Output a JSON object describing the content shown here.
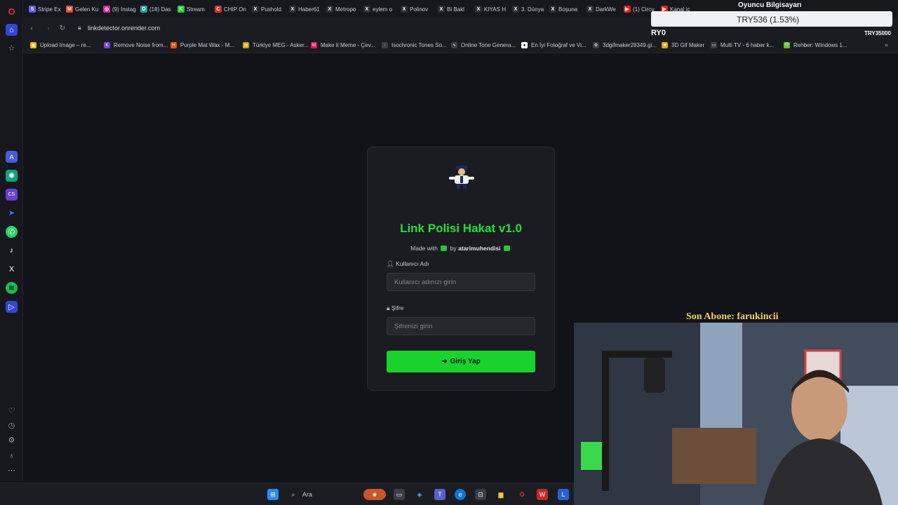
{
  "browser": {
    "url": "linkdetector.onrender.com",
    "tabs": [
      {
        "label": "Stripe Ex",
        "color": "#635bff",
        "glyph": "S"
      },
      {
        "label": "Gelen Ku",
        "color": "#ea4335",
        "glyph": "M"
      },
      {
        "label": "(9) Instag",
        "color": "#d6249f",
        "glyph": "◎"
      },
      {
        "label": "(18) Das",
        "color": "#2aa198",
        "glyph": "D"
      },
      {
        "label": "Stream",
        "color": "#19d32c",
        "glyph": "K"
      },
      {
        "label": "CHIP On",
        "color": "#d32f2f",
        "glyph": "C"
      },
      {
        "label": "Pushold",
        "color": "#2b2e35",
        "glyph": "X"
      },
      {
        "label": "Haber61",
        "color": "#2b2e35",
        "glyph": "X"
      },
      {
        "label": "Metropo",
        "color": "#2b2e35",
        "glyph": "X"
      },
      {
        "label": "eylem o",
        "color": "#2b2e35",
        "glyph": "X"
      },
      {
        "label": "Polinov",
        "color": "#2b2e35",
        "glyph": "X"
      },
      {
        "label": "Bi Bakl",
        "color": "#2b2e35",
        "glyph": "X"
      },
      {
        "label": "KIYAS H",
        "color": "#2b2e35",
        "glyph": "X"
      },
      {
        "label": "3. Dünya",
        "color": "#2b2e35",
        "glyph": "X"
      },
      {
        "label": "Boşuna",
        "color": "#2b2e35",
        "glyph": "X"
      },
      {
        "label": "DarkWe",
        "color": "#2b2e35",
        "glyph": "X"
      },
      {
        "label": "(1) Circu",
        "color": "#e62117",
        "glyph": "▶"
      },
      {
        "label": "Kanal iç",
        "color": "#e62117",
        "glyph": "▶"
      }
    ],
    "bookmarks": [
      {
        "label": "Upload Image – re...",
        "color": "#f2b400",
        "glyph": "▣"
      },
      {
        "label": "Remove Noise from...",
        "color": "#7b3fe4",
        "glyph": "K"
      },
      {
        "label": "Purple Mat Wax - M...",
        "color": "#e65100",
        "glyph": "H"
      },
      {
        "label": "Türkiye MEG - Asker...",
        "color": "#c8a100",
        "glyph": "▤"
      },
      {
        "label": "Make it Meme - Çev...",
        "color": "#d81b60",
        "glyph": "M"
      },
      {
        "label": "Isochronic Tones So...",
        "color": "#3b3e45",
        "glyph": "◌"
      },
      {
        "label": "Online Tone Genera...",
        "color": "#3b3e45",
        "glyph": "∿"
      },
      {
        "label": "En İyi Fotoğraf ve Vi...",
        "color": "#ffffff",
        "glyph": "●"
      },
      {
        "label": "3dgifmaker28349.gi...",
        "color": "#3b3e45",
        "glyph": "⚙"
      },
      {
        "label": "3D Gif Maker",
        "color": "#e8a317",
        "glyph": "✹"
      },
      {
        "label": "Multi TV - 6 haber k...",
        "color": "#3b3e45",
        "glyph": "▭"
      },
      {
        "label": "Rehber: Windows 1...",
        "color": "#5fc52e",
        "glyph": "⏻"
      }
    ]
  },
  "overlay": {
    "title": "Oyuncu Bilgisayarı",
    "price": "TRY536 (1.53%)",
    "ticker_left": "RY0",
    "ticker_right": "TRY35000",
    "subscriber": "Son Abone: farukincii"
  },
  "login": {
    "title": "Link Polisi Hakat v1.0",
    "made_with_prefix": "Made with",
    "made_with_by": "by",
    "author": "atarimuhendisi",
    "username_label": "Kullanıcı Adı",
    "username_placeholder": "Kullanıcı adınızı girin",
    "password_label": "Şifre",
    "password_placeholder": "Şifrenizi girin",
    "submit_label": "Giriş Yap",
    "accent": "#19d32c"
  },
  "taskbar": {
    "search_label": "Ara"
  }
}
